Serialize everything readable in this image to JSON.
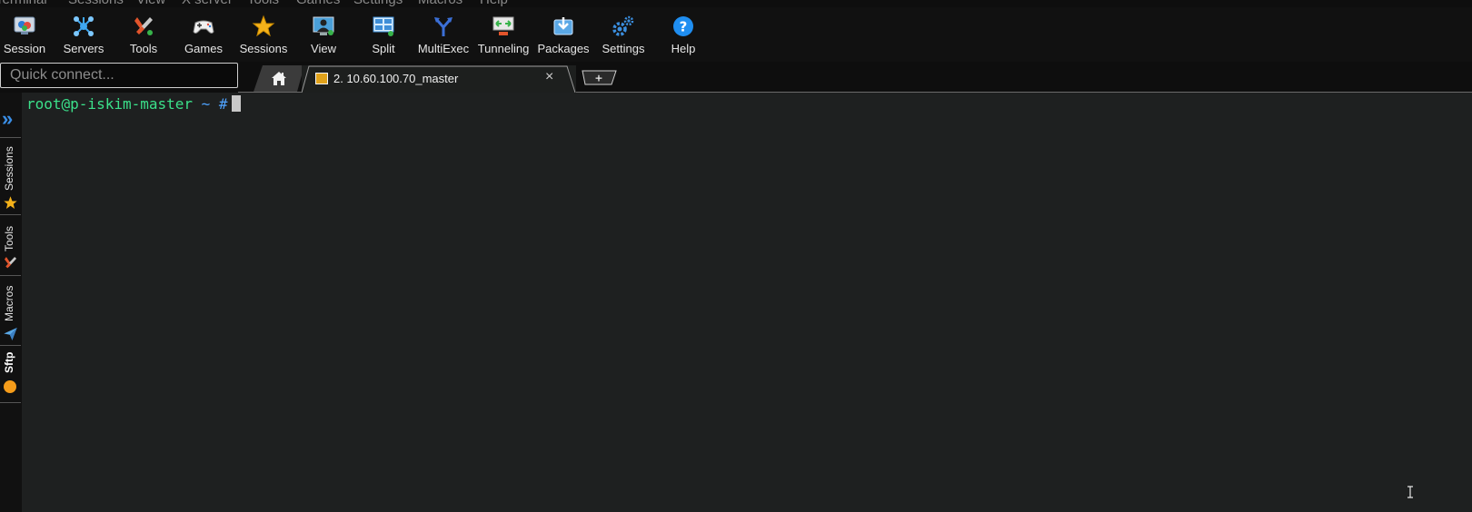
{
  "menu": [
    "Terminal",
    "Sessions",
    "View",
    "X server",
    "Tools",
    "Games",
    "Settings",
    "Macros",
    "Help"
  ],
  "toolbar": [
    {
      "label": "Session",
      "icon": "session-icon"
    },
    {
      "label": "Servers",
      "icon": "servers-icon"
    },
    {
      "label": "Tools",
      "icon": "tools-icon"
    },
    {
      "label": "Games",
      "icon": "gamepad-icon"
    },
    {
      "label": "Sessions",
      "icon": "star-icon"
    },
    {
      "label": "View",
      "icon": "monitor-user-icon"
    },
    {
      "label": "Split",
      "icon": "split-window-icon"
    },
    {
      "label": "MultiExec",
      "icon": "fork-arrows-icon"
    },
    {
      "label": "Tunneling",
      "icon": "tunnel-icon"
    },
    {
      "label": "Packages",
      "icon": "package-download-icon"
    },
    {
      "label": "Settings",
      "icon": "gears-icon"
    },
    {
      "label": "Help",
      "icon": "question-icon"
    }
  ],
  "quick_connect": {
    "placeholder": "Quick connect..."
  },
  "tabs": {
    "home_icon": "home-icon",
    "active": {
      "title": "2. 10.60.100.70_master",
      "close": "×"
    },
    "new_tab": "+"
  },
  "sidebar": {
    "collapse": "»",
    "items": [
      {
        "label": "Sessions",
        "icon": "star-icon"
      },
      {
        "label": "Tools",
        "icon": "tools-icon"
      },
      {
        "label": "Macros",
        "icon": "paper-plane-icon"
      },
      {
        "label": "Sftp",
        "icon": "orange-dot-icon"
      }
    ]
  },
  "terminal": {
    "user_host": "root@p-iskim-master",
    "path_symbol": " ~ #",
    "colors": {
      "background": "#1e2020",
      "user": "#3be08a",
      "path": "#4fa3ff"
    }
  }
}
